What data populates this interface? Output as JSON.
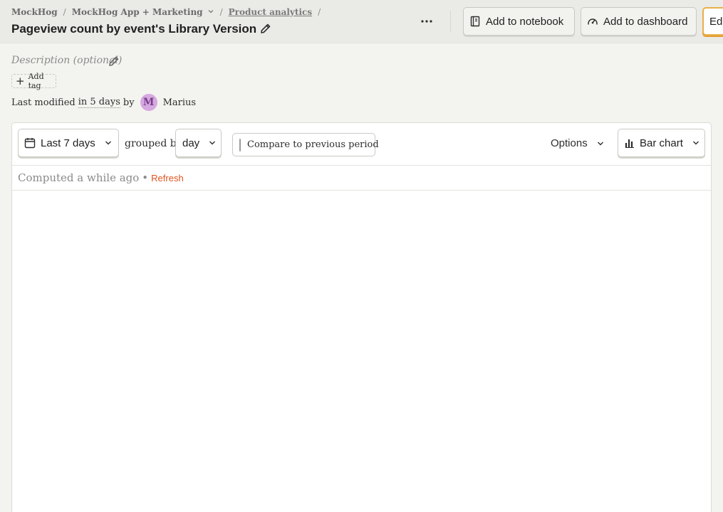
{
  "breadcrumb": {
    "org": "MockHog",
    "separator": "/",
    "project": "MockHog App + Marketing",
    "section": "Product analytics"
  },
  "insight": {
    "title": "Pageview count by event's Library Version",
    "description_placeholder": "Description (optional)",
    "add_tag_label": "Add tag"
  },
  "header_actions": {
    "add_to_notebook": "Add to notebook",
    "add_to_dashboard": "Add to dashboard",
    "edit": "Edit"
  },
  "modified": {
    "prefix": "Last modified",
    "when": "in 5 days",
    "by": "by",
    "avatar_initial": "M",
    "user": "Marius"
  },
  "filters": {
    "date_range": "Last 7 days",
    "grouped_by": "grouped by",
    "interval": "day",
    "compare_label": "Compare to previous period",
    "compare_checked": false,
    "options": "Options",
    "chart_type": "Bar chart"
  },
  "status": {
    "computed": "Computed a while ago",
    "bullet": "•",
    "refresh": "Refresh"
  },
  "colors": {
    "accent": "#e0531f",
    "edit_border": "#e8b04a",
    "avatar_bg": "#d6a8e0"
  },
  "icons": [
    "chevron-down-icon",
    "pencil-icon",
    "more-icon",
    "notebook-icon",
    "dashboard-icon",
    "plus-icon",
    "calendar-icon",
    "bar-chart-icon"
  ]
}
